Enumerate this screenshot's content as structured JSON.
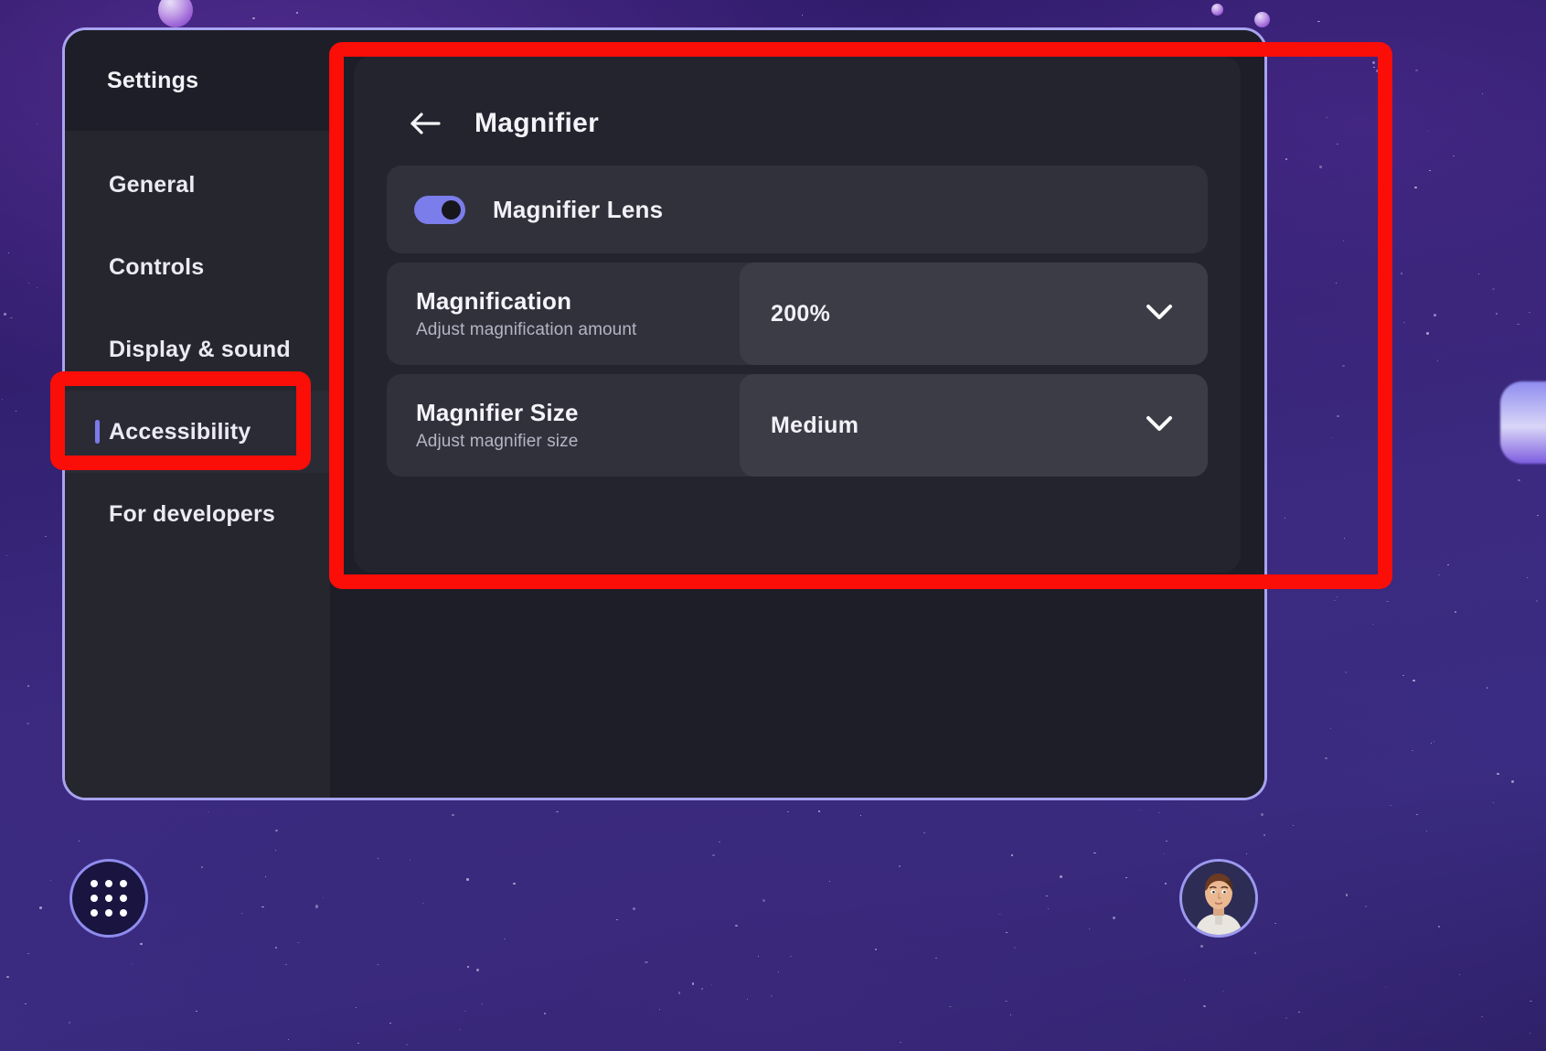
{
  "window": {
    "sidebar": {
      "title": "Settings",
      "items": [
        {
          "label": "General",
          "selected": false
        },
        {
          "label": "Controls",
          "selected": false
        },
        {
          "label": "Display & sound",
          "selected": false
        },
        {
          "label": "Accessibility",
          "selected": true
        },
        {
          "label": "For developers",
          "selected": false
        }
      ]
    },
    "panel": {
      "back_icon": "back-arrow-icon",
      "title": "Magnifier",
      "toggle_row": {
        "label": "Magnifier Lens",
        "state": "on"
      },
      "settings": [
        {
          "title": "Magnification",
          "subtitle": "Adjust magnification amount",
          "value": "200%",
          "icon": "chevron-down-icon"
        },
        {
          "title": "Magnifier Size",
          "subtitle": "Adjust magnifier size",
          "value": "Medium",
          "icon": "chevron-down-icon"
        }
      ]
    }
  },
  "dock": {
    "app_launcher_icon": "grid-dots-icon",
    "avatar_icon": "user-avatar-icon"
  },
  "annotations": {
    "color": "#fb0d08",
    "boxes": [
      {
        "name": "magnifier-panel-highlight"
      },
      {
        "name": "accessibility-nav-highlight"
      }
    ]
  },
  "theme": {
    "accent": "#7b7dea",
    "window_border": "#a8a4f0",
    "panel_bg": "#24242e",
    "row_bg": "#31313c",
    "control_bg": "#3c3c46",
    "text_primary": "#f2f1f7",
    "text_secondary": "#b6b4c4"
  }
}
